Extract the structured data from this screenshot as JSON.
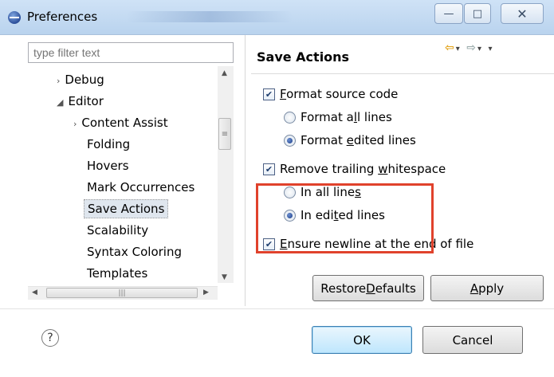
{
  "window": {
    "title": "Preferences",
    "minimize_glyph": "—",
    "maximize_glyph": "□",
    "close_glyph": "✕"
  },
  "filter": {
    "placeholder": "type filter text"
  },
  "tree": {
    "items": [
      {
        "label": "Debug",
        "twisty": "›"
      },
      {
        "label": "Editor",
        "twisty": "◢"
      },
      {
        "label": "Content Assist",
        "twisty": "›"
      },
      {
        "label": "Folding"
      },
      {
        "label": "Hovers"
      },
      {
        "label": "Mark Occurrences"
      },
      {
        "label": "Save Actions",
        "selected": true
      },
      {
        "label": "Scalability"
      },
      {
        "label": "Syntax Coloring"
      },
      {
        "label": "Templates"
      }
    ]
  },
  "page": {
    "title": "Save Actions",
    "nav_back": "⇦",
    "nav_forward": "⇨",
    "menu_glyph": "▾"
  },
  "options": {
    "format_source": {
      "label_pre": "",
      "label_ul": "F",
      "label_post": "ormat source code",
      "checked": true
    },
    "format_all": {
      "label_pre": "Format a",
      "label_ul": "l",
      "label_post": "l lines",
      "selected": false
    },
    "format_edited": {
      "label_pre": "Format ",
      "label_ul": "e",
      "label_post": "dited lines",
      "selected": true
    },
    "remove_ws": {
      "label_pre": "Remove trailing ",
      "label_ul": "w",
      "label_post": "hitespace",
      "checked": true
    },
    "ws_all": {
      "label_pre": "In all line",
      "label_ul": "s",
      "label_post": "",
      "selected": false
    },
    "ws_edited": {
      "label_pre": "In edi",
      "label_ul": "t",
      "label_post": "ed lines",
      "selected": true
    },
    "ensure_newline": {
      "label_pre": "",
      "label_ul": "E",
      "label_post": "nsure newline at the end of file",
      "checked": true
    }
  },
  "buttons": {
    "restore_pre": "Restore ",
    "restore_ul": "D",
    "restore_post": "efaults",
    "apply_ul": "A",
    "apply_post": "pply",
    "ok": "OK",
    "cancel": "Cancel",
    "help": "?"
  },
  "colors": {
    "highlight": "#e0422c",
    "selection": "#dfe6ee",
    "accent": "#3c7fb1"
  }
}
